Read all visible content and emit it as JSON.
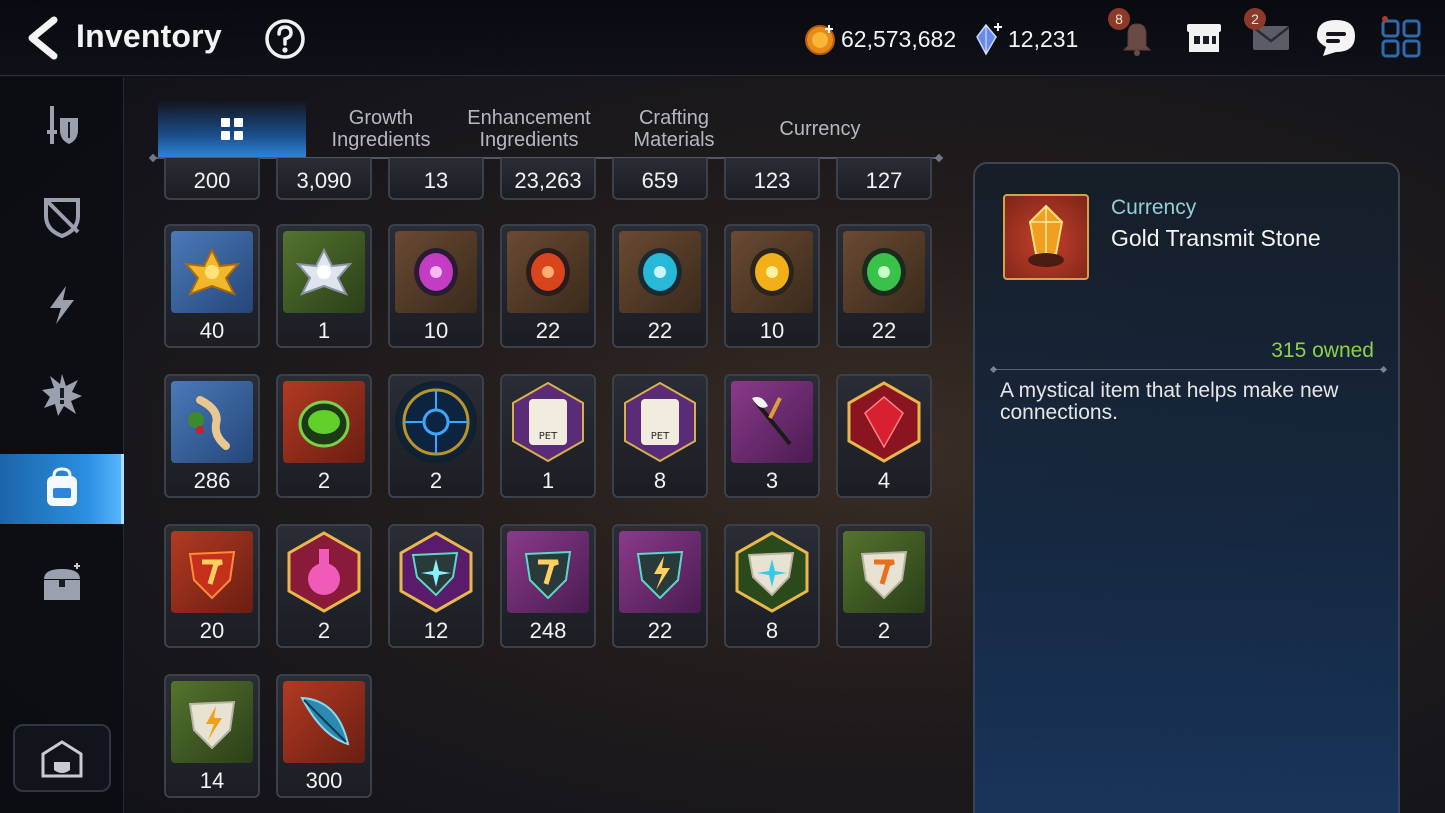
{
  "header": {
    "title": "Inventory",
    "gold": "62,573,682",
    "crystals": "12,231",
    "notif_count": "8",
    "mail_count": "2"
  },
  "tabs": [
    {
      "label": "",
      "icon": "grid-icon",
      "active": true
    },
    {
      "label": "Growth\nIngredients",
      "active": false
    },
    {
      "label": "Enhancement\nIngredients",
      "active": false
    },
    {
      "label": "Crafting\nMaterials",
      "active": false
    },
    {
      "label": "Currency",
      "active": false
    }
  ],
  "tab_labels": {
    "growth_1": "Growth",
    "growth_2": "Ingredients",
    "enh_1": "Enhancement",
    "enh_2": "Ingredients",
    "craft_1": "Crafting",
    "craft_2": "Materials",
    "currency": "Currency"
  },
  "sidebar": {
    "items": [
      {
        "name": "sword-shield-icon"
      },
      {
        "name": "broken-shield-icon"
      },
      {
        "name": "lightning-icon"
      },
      {
        "name": "spiky-burst-icon"
      },
      {
        "name": "backpack-icon",
        "active": true
      },
      {
        "name": "treasure-chest-icon"
      }
    ],
    "bottom": "castle-icon"
  },
  "grid": {
    "row0": [
      "200",
      "3,090",
      "13",
      "23,263",
      "659",
      "123",
      "127"
    ],
    "row1": [
      {
        "count": "40",
        "icon": "gold-lotus-icon"
      },
      {
        "count": "1",
        "icon": "silver-lotus-icon"
      },
      {
        "count": "10",
        "icon": "purple-rune-icon"
      },
      {
        "count": "22",
        "icon": "red-rune-icon"
      },
      {
        "count": "22",
        "icon": "cyan-rune-icon"
      },
      {
        "count": "10",
        "icon": "yellow-rune-icon"
      },
      {
        "count": "22",
        "icon": "green-rune-icon"
      }
    ],
    "row2": [
      {
        "count": "286",
        "icon": "ginseng-root-icon"
      },
      {
        "count": "2",
        "icon": "green-potion-bowl-icon"
      },
      {
        "count": "2",
        "icon": "blue-circuit-orb-icon"
      },
      {
        "count": "1",
        "icon": "pet-food-bag-icon"
      },
      {
        "count": "8",
        "icon": "pet-food-bag-icon"
      },
      {
        "count": "3",
        "icon": "feather-wand-icon"
      },
      {
        "count": "4",
        "icon": "red-gem-icon"
      }
    ],
    "row3": [
      {
        "count": "20",
        "icon": "red-charm-stone-icon"
      },
      {
        "count": "2",
        "icon": "pink-potion-icon"
      },
      {
        "count": "12",
        "icon": "teal-star-stone-icon"
      },
      {
        "count": "248",
        "icon": "teal-charm-stone-icon"
      },
      {
        "count": "22",
        "icon": "teal-bolt-stone-icon"
      },
      {
        "count": "8",
        "icon": "white-star-stone-icon"
      },
      {
        "count": "2",
        "icon": "white-charm-stone-icon"
      }
    ],
    "row4": [
      {
        "count": "14",
        "icon": "white-bolt-stone-icon"
      },
      {
        "count": "300",
        "icon": "blue-feather-icon"
      }
    ]
  },
  "detail": {
    "category": "Currency",
    "name": "Gold Transmit Stone",
    "owned": "315 owned",
    "description": "A mystical item that helps make new connections."
  },
  "colors": {
    "accent_blue": "#2f86d8",
    "owned_green": "#8ed04a",
    "category_cyan": "#8fd0da"
  }
}
